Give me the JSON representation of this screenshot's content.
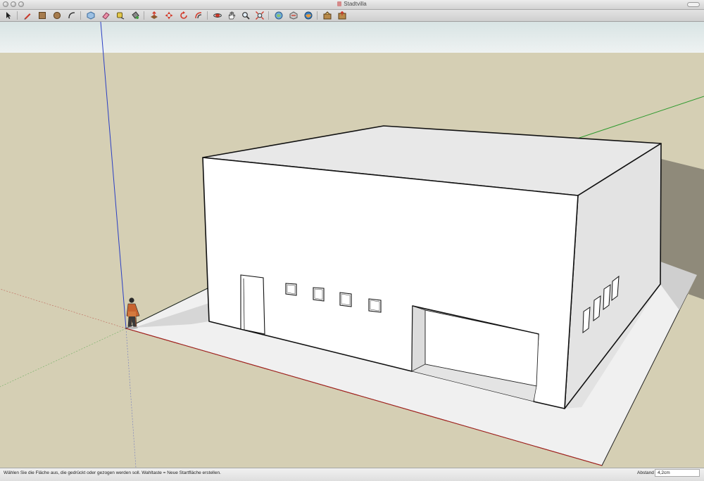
{
  "window": {
    "title": "Stadtvilla"
  },
  "toolbar": {
    "tools": [
      {
        "icon": "select-arrow-icon"
      },
      {
        "icon": "pencil-line-icon"
      },
      {
        "icon": "rectangle-icon"
      },
      {
        "icon": "circle-icon"
      },
      {
        "icon": "arc-icon"
      },
      {
        "icon": "make-component-icon"
      },
      {
        "icon": "eraser-icon"
      },
      {
        "icon": "tape-measure-icon"
      },
      {
        "icon": "paint-bucket-icon"
      },
      {
        "icon": "push-pull-icon"
      },
      {
        "icon": "move-icon"
      },
      {
        "icon": "rotate-icon"
      },
      {
        "icon": "offset-icon"
      },
      {
        "icon": "orbit-icon"
      },
      {
        "icon": "pan-hand-icon"
      },
      {
        "icon": "zoom-icon"
      },
      {
        "icon": "zoom-extents-icon"
      },
      {
        "icon": "3d-warehouse-icon"
      },
      {
        "icon": "share-model-icon"
      },
      {
        "icon": "google-earth-icon"
      },
      {
        "icon": "get-models-icon"
      },
      {
        "icon": "share-component-icon"
      }
    ]
  },
  "status": {
    "message": "Wählen Sie die Fläche aus, die gedrückt oder gezogen werden soll. Wahltaste = Neue Startfläche erstellen.",
    "measure_label": "Abstand",
    "measure_value": "4,2cm"
  },
  "colors": {
    "ground": "#d5cfb4",
    "sky": "#e4ecec",
    "axis_red": "#b0201c",
    "axis_green": "#2e9a2e",
    "axis_blue": "#2b3fc4",
    "toolbar_accent": "#d23a2a"
  }
}
